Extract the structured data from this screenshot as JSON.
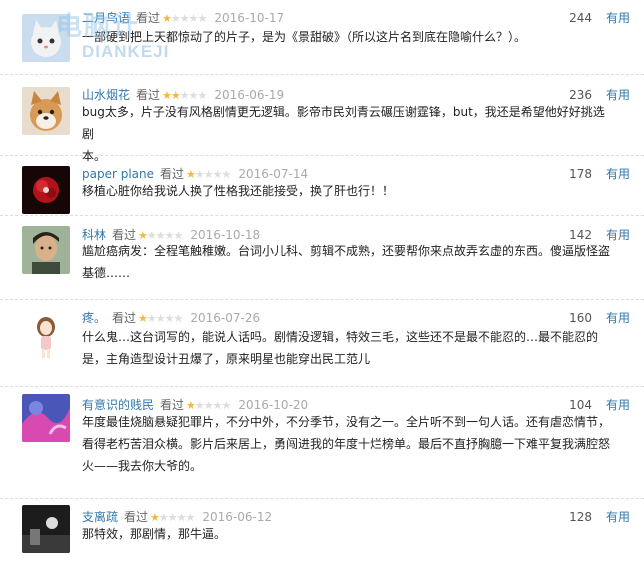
{
  "useful_label": "有用",
  "watched_label": "看过",
  "watermark": {
    "cn": "电脑计",
    "en": "DIANKEJI"
  },
  "colors": {
    "link": "#3377aa",
    "star": "#f4b73f",
    "star_empty": "#dddddd",
    "date": "#aaaaaa"
  },
  "comments": [
    {
      "user": "二月鸟语",
      "rating": 1,
      "date": "2016-10-17",
      "votes": "244",
      "avatar_icon": "cat-face-avatar",
      "lines": [
        "一部硬到把上天都惊动了的片子，是为《景甜破》（所以这片名到底在隐喻什么？）。"
      ]
    },
    {
      "user": "山水烟花",
      "rating": 2,
      "date": "2016-06-19",
      "votes": "236",
      "avatar_icon": "shiba-dog-avatar",
      "lines": [
        "bug太多，片子没有风格剧情更无逻辑。影帝市民刘青云碾压谢霆锋，but，我还是希望他好好挑选剧",
        "本。"
      ]
    },
    {
      "user": "paper plane",
      "rating": 1,
      "date": "2016-07-14",
      "votes": "178",
      "avatar_icon": "red-flower-avatar",
      "lines": [
        "移植心脏你给我说人换了性格我还能接受，换了肝也行！！"
      ]
    },
    {
      "user": "科林",
      "rating": 1,
      "date": "2016-10-18",
      "votes": "142",
      "avatar_icon": "man-portrait-avatar",
      "lines": [
        "尴尬癌病发：全程笔触稚嫩。台词小儿科、剪辑不成熟，还要帮你来点故弄玄虚的东西。傻逼版怪盗",
        "基德……"
      ]
    },
    {
      "user": "疼。",
      "rating": 1,
      "date": "2016-07-26",
      "votes": "160",
      "avatar_icon": "anime-girl-avatar",
      "lines": [
        "什么鬼…这台词写的，能说人话吗。剧情没逻辑，特效三毛，这些还不是最不能忍的…最不能忍的",
        "是，主角造型设计丑爆了，原来明星也能穿出民工范儿"
      ]
    },
    {
      "user": "有意识的贱民",
      "rating": 1,
      "date": "2016-10-20",
      "votes": "104",
      "avatar_icon": "abstract-art-avatar",
      "lines": [
        "年度最佳烧脑悬疑犯罪片，不分中外，不分季节，没有之一。全片听不到一句人话。还有虐恋情节，",
        "看得老朽苦泪众横。影片后来居上，勇闯进我的年度十烂榜单。最后不直抒胸臆一下难平复我满腔怒",
        "火——我去你大爷的。"
      ]
    },
    {
      "user": "支离疏",
      "rating": 1,
      "date": "2016-06-12",
      "votes": "128",
      "avatar_icon": "dark-photo-avatar",
      "lines": [
        "那特效，那剧情，那牛逼。"
      ]
    }
  ]
}
